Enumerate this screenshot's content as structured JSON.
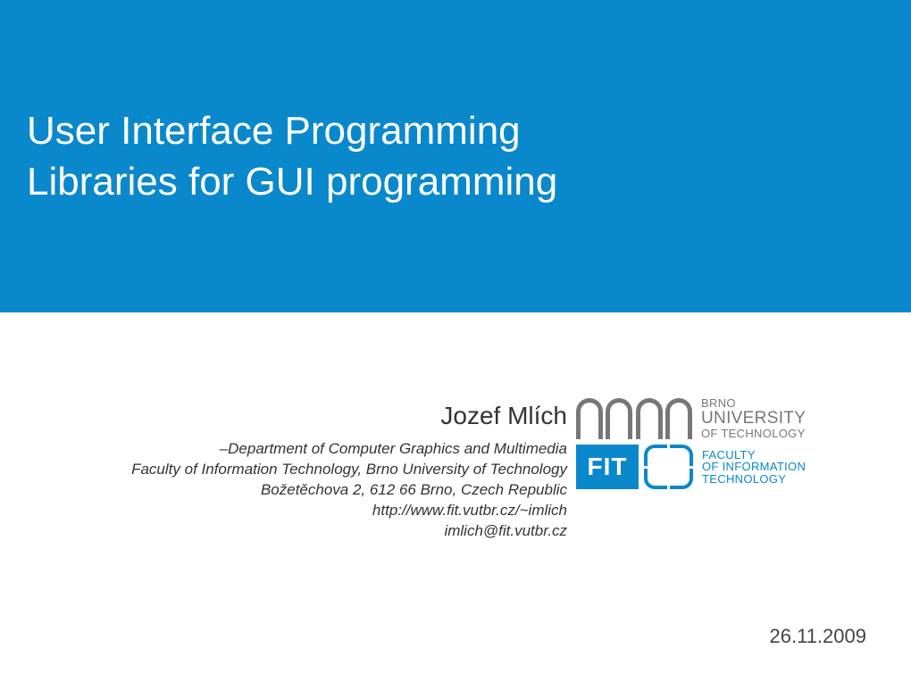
{
  "title": {
    "line1": "User Interface Programming",
    "line2": "Libraries for GUI programming"
  },
  "author": "Jozef Mlích",
  "department_prefix": "–",
  "department": "Department of Computer Graphics and Multimedia",
  "faculty": "Faculty of Information Technology, Brno University of Technology",
  "address": "Božetěchova 2, 612 66 Brno, Czech Republic",
  "url": "http://www.fit.vutbr.cz/~imlich",
  "email": "imlich@fit.vutbr.cz",
  "logo_university": {
    "line1": "BRNO",
    "line2": "UNIVERSITY",
    "line3": "OF TECHNOLOGY"
  },
  "logo_fit": {
    "mark": "FIT",
    "line1": "FACULTY",
    "line2": "OF INFORMATION",
    "line3": "TECHNOLOGY"
  },
  "date": "26.11.2009"
}
